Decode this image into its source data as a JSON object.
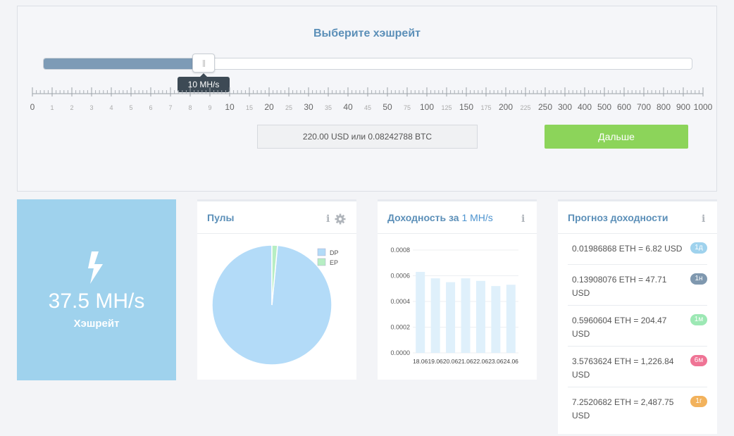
{
  "selector": {
    "title": "Выберите хэшрейт",
    "slider_fraction": 0.2478,
    "tooltip": "10 MH/s",
    "tick_labels": [
      "0",
      "1",
      "2",
      "3",
      "4",
      "5",
      "6",
      "7",
      "8",
      "9",
      "10",
      "15",
      "20",
      "25",
      "30",
      "35",
      "40",
      "45",
      "50",
      "75",
      "100",
      "125",
      "150",
      "175",
      "200",
      "225",
      "250",
      "300",
      "400",
      "500",
      "600",
      "700",
      "800",
      "900",
      "1000"
    ],
    "tick_major": [
      true,
      false,
      false,
      false,
      false,
      false,
      false,
      false,
      false,
      false,
      true,
      false,
      true,
      false,
      true,
      false,
      true,
      false,
      true,
      false,
      true,
      false,
      true,
      false,
      true,
      false,
      true,
      true,
      true,
      true,
      true,
      true,
      true,
      true,
      true
    ],
    "price": "220.00 USD или 0.08242788 BTC",
    "next_label": "Дальше"
  },
  "hashrate": {
    "value": "37.5 MH/s",
    "label": "Хэшрейт",
    "icon": "lightning-bolt-icon"
  },
  "pools": {
    "title": "Пулы",
    "icons": [
      "info-icon",
      "gear-icon"
    ],
    "chart_data": {
      "type": "pie",
      "labels": [
        "DP",
        "EP"
      ],
      "values": [
        98.5,
        1.5
      ],
      "colors": [
        "#b3dbf8",
        "#b7eec3"
      ],
      "legend_position": "top-right"
    }
  },
  "profit": {
    "title_prefix": "Доходность за",
    "title_highlight": "1 MH/s",
    "chart_data": {
      "type": "bar",
      "categories": [
        "18.06",
        "19.06",
        "20.06",
        "21.06",
        "22.06",
        "23.06",
        "24.06"
      ],
      "values": [
        0.00063,
        0.00058,
        0.00055,
        0.00058,
        0.00056,
        0.00052,
        0.00053
      ],
      "yticks": [
        "0.0000",
        "0.0002",
        "0.0004",
        "0.0006",
        "0.0008"
      ],
      "ylim": [
        0,
        0.0008
      ],
      "color": "#dff0fb"
    }
  },
  "forecast": {
    "title": "Прогноз доходности",
    "rows": [
      {
        "text": "0.01986868 ETH = 6.82 USD",
        "badge": "1д",
        "color": "#9fd2ed"
      },
      {
        "text": "0.13908076 ETH = 47.71 USD",
        "badge": "1н",
        "color": "#7f98af"
      },
      {
        "text": "0.5960604 ETH = 204.47 USD",
        "badge": "1м",
        "color": "#9ce8b4"
      },
      {
        "text": "3.5763624 ETH = 1,226.84 USD",
        "badge": "6м",
        "color": "#ef7495"
      },
      {
        "text": "7.2520682 ETH = 2,487.75 USD",
        "badge": "1г",
        "color": "#f2b25c"
      }
    ]
  }
}
